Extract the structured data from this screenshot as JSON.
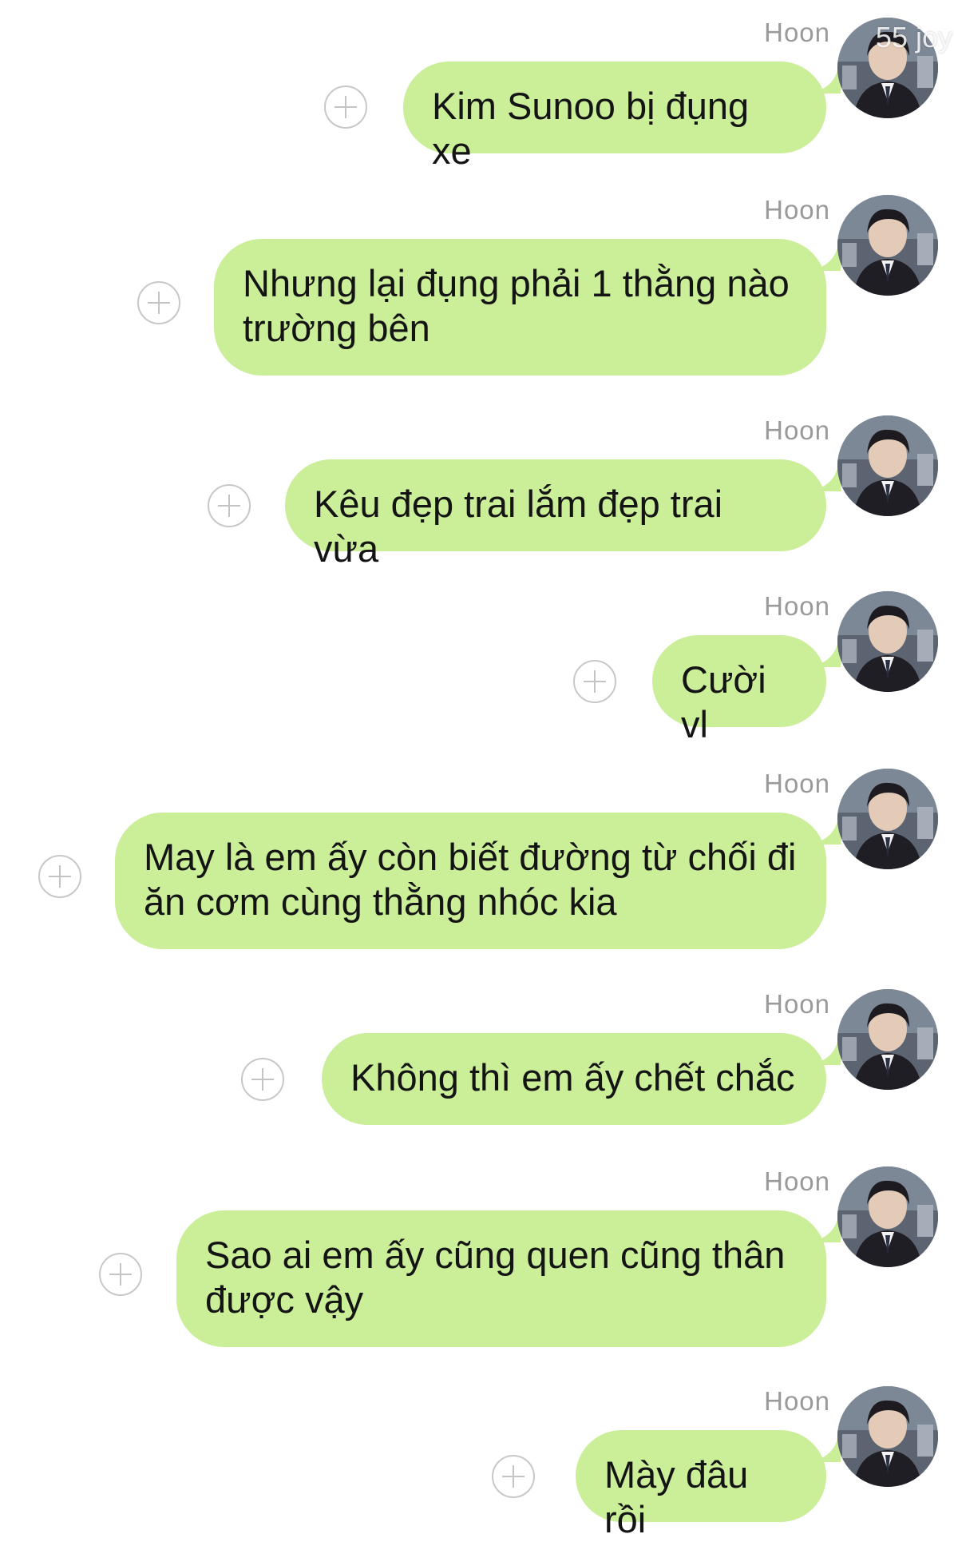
{
  "watermark": "55 joy",
  "colors": {
    "bubble": "#cbee99",
    "sender": "#9a9a9a",
    "add_button": "#c8c8c8"
  },
  "icons": {
    "add": "plus-circle-icon",
    "avatar": "profile-photo"
  },
  "messages": [
    {
      "sender": "Hoon",
      "text": "Kim Sunoo bị đụng xe"
    },
    {
      "sender": "Hoon",
      "text": "Nhưng lại đụng phải 1 thằng nào\ntrường bên"
    },
    {
      "sender": "Hoon",
      "text": "Kêu đẹp trai lắm đẹp trai vừa"
    },
    {
      "sender": "Hoon",
      "text": "Cười vl"
    },
    {
      "sender": "Hoon",
      "text": "May là em ấy còn biết đường từ chối đi\năn cơm cùng thằng nhóc kia"
    },
    {
      "sender": "Hoon",
      "text": "Không thì em ấy chết chắc"
    },
    {
      "sender": "Hoon",
      "text": "Sao ai em ấy cũng quen cũng thân\nđược vậy"
    },
    {
      "sender": "Hoon",
      "text": "Mày đâu rồi"
    }
  ]
}
